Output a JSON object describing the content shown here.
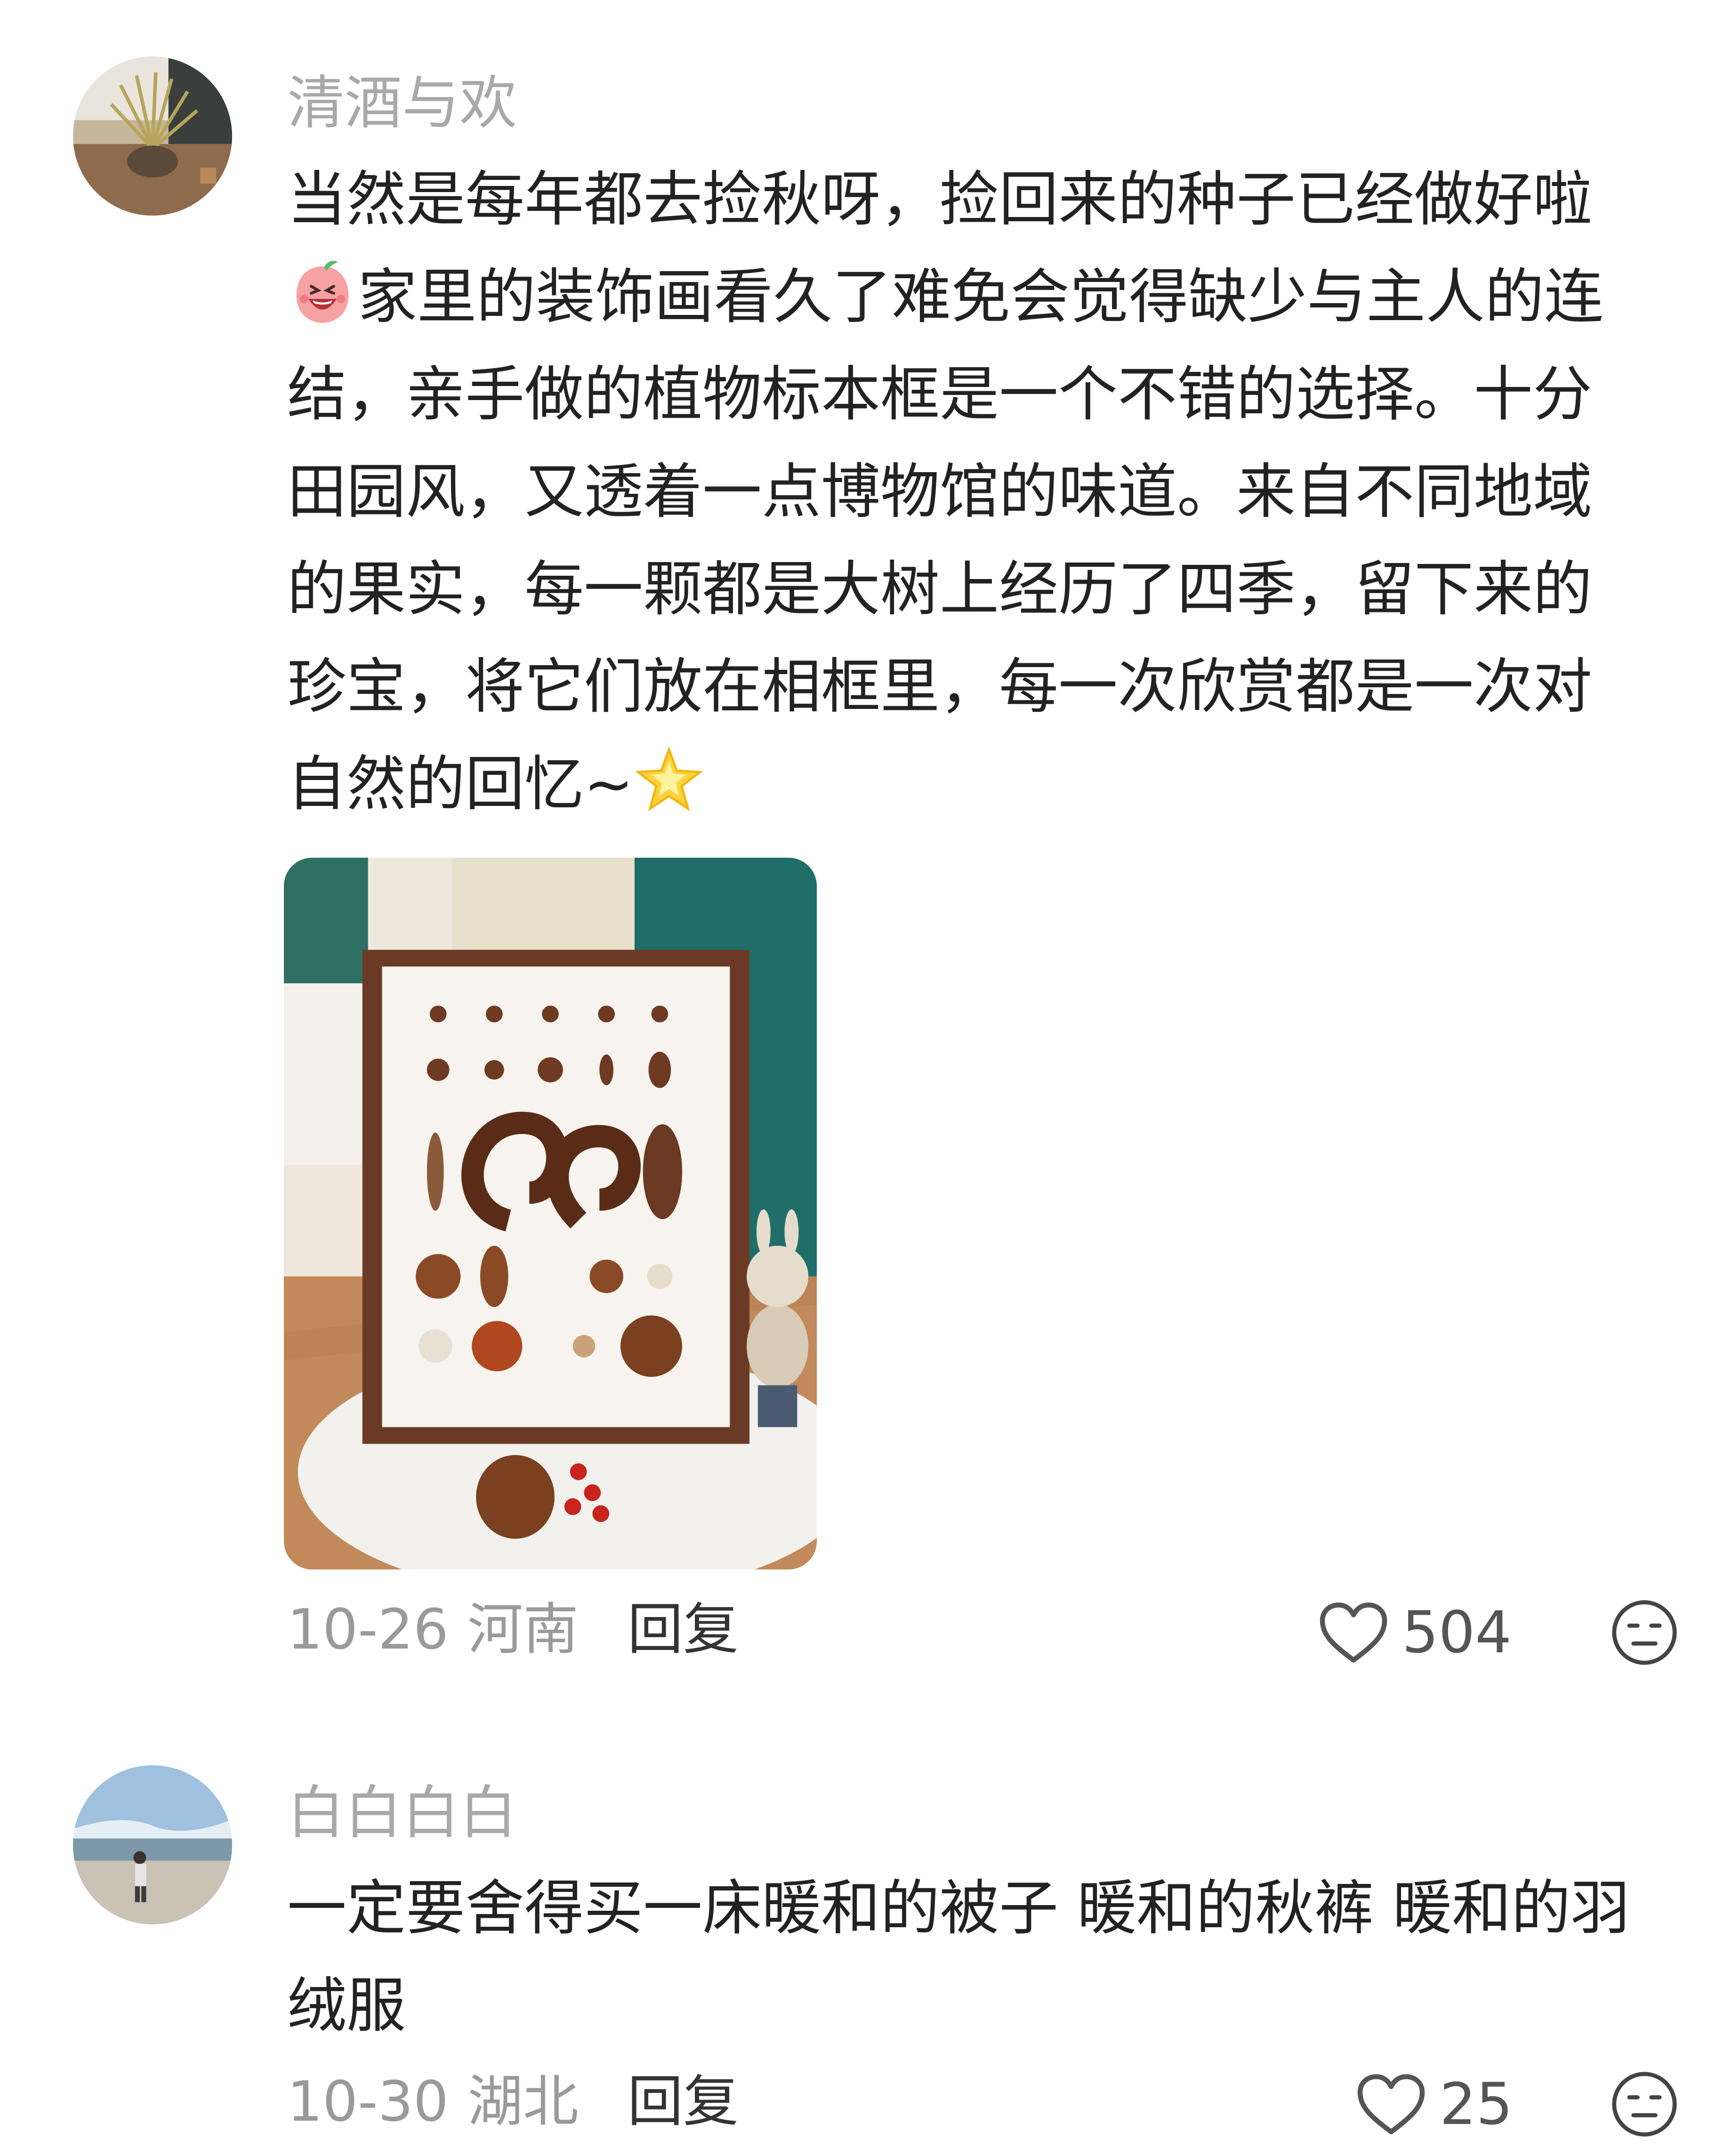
{
  "comments": [
    {
      "username": "清酒与欢",
      "avatar_icon": "wheat-plant-avatar",
      "lines": [
        "当然是每年都去捡秋呀，捡回来的种子已经做好啦",
        "家里的装饰画看久了难免会觉得缺少与主人的连",
        "结，亲手做的植物标本框是一个不错的选择。十分",
        "田园风，又透着一点博物馆的味道。来自不同地域",
        "的果实，每一颗都是大树上经历了四季，留下来的",
        "珍宝，将它们放在相框里，每一次欣赏都是一次对",
        "自然的回忆~"
      ],
      "emojis": [
        "laughing-peach-emoji",
        "sparkle-star-emoji"
      ],
      "image_icon": "seed-specimen-frame-photo",
      "date": "10-26",
      "location": "河南",
      "reply_label": "回复",
      "likes": "504"
    },
    {
      "username": "白白白白",
      "avatar_icon": "beach-person-avatar",
      "lines": [
        "一定要舍得买一床暖和的被子 暖和的秋裤 暖和的羽",
        "绒服"
      ],
      "date": "10-30",
      "location": "湖北",
      "reply_label": "回复",
      "likes": "25"
    }
  ],
  "colors": {
    "username": "#a9a9a9",
    "body": "#222222",
    "meta": "#9a9a9a",
    "frame_wood": "#6b3a26",
    "teal_wall": "#1f6e6a"
  }
}
